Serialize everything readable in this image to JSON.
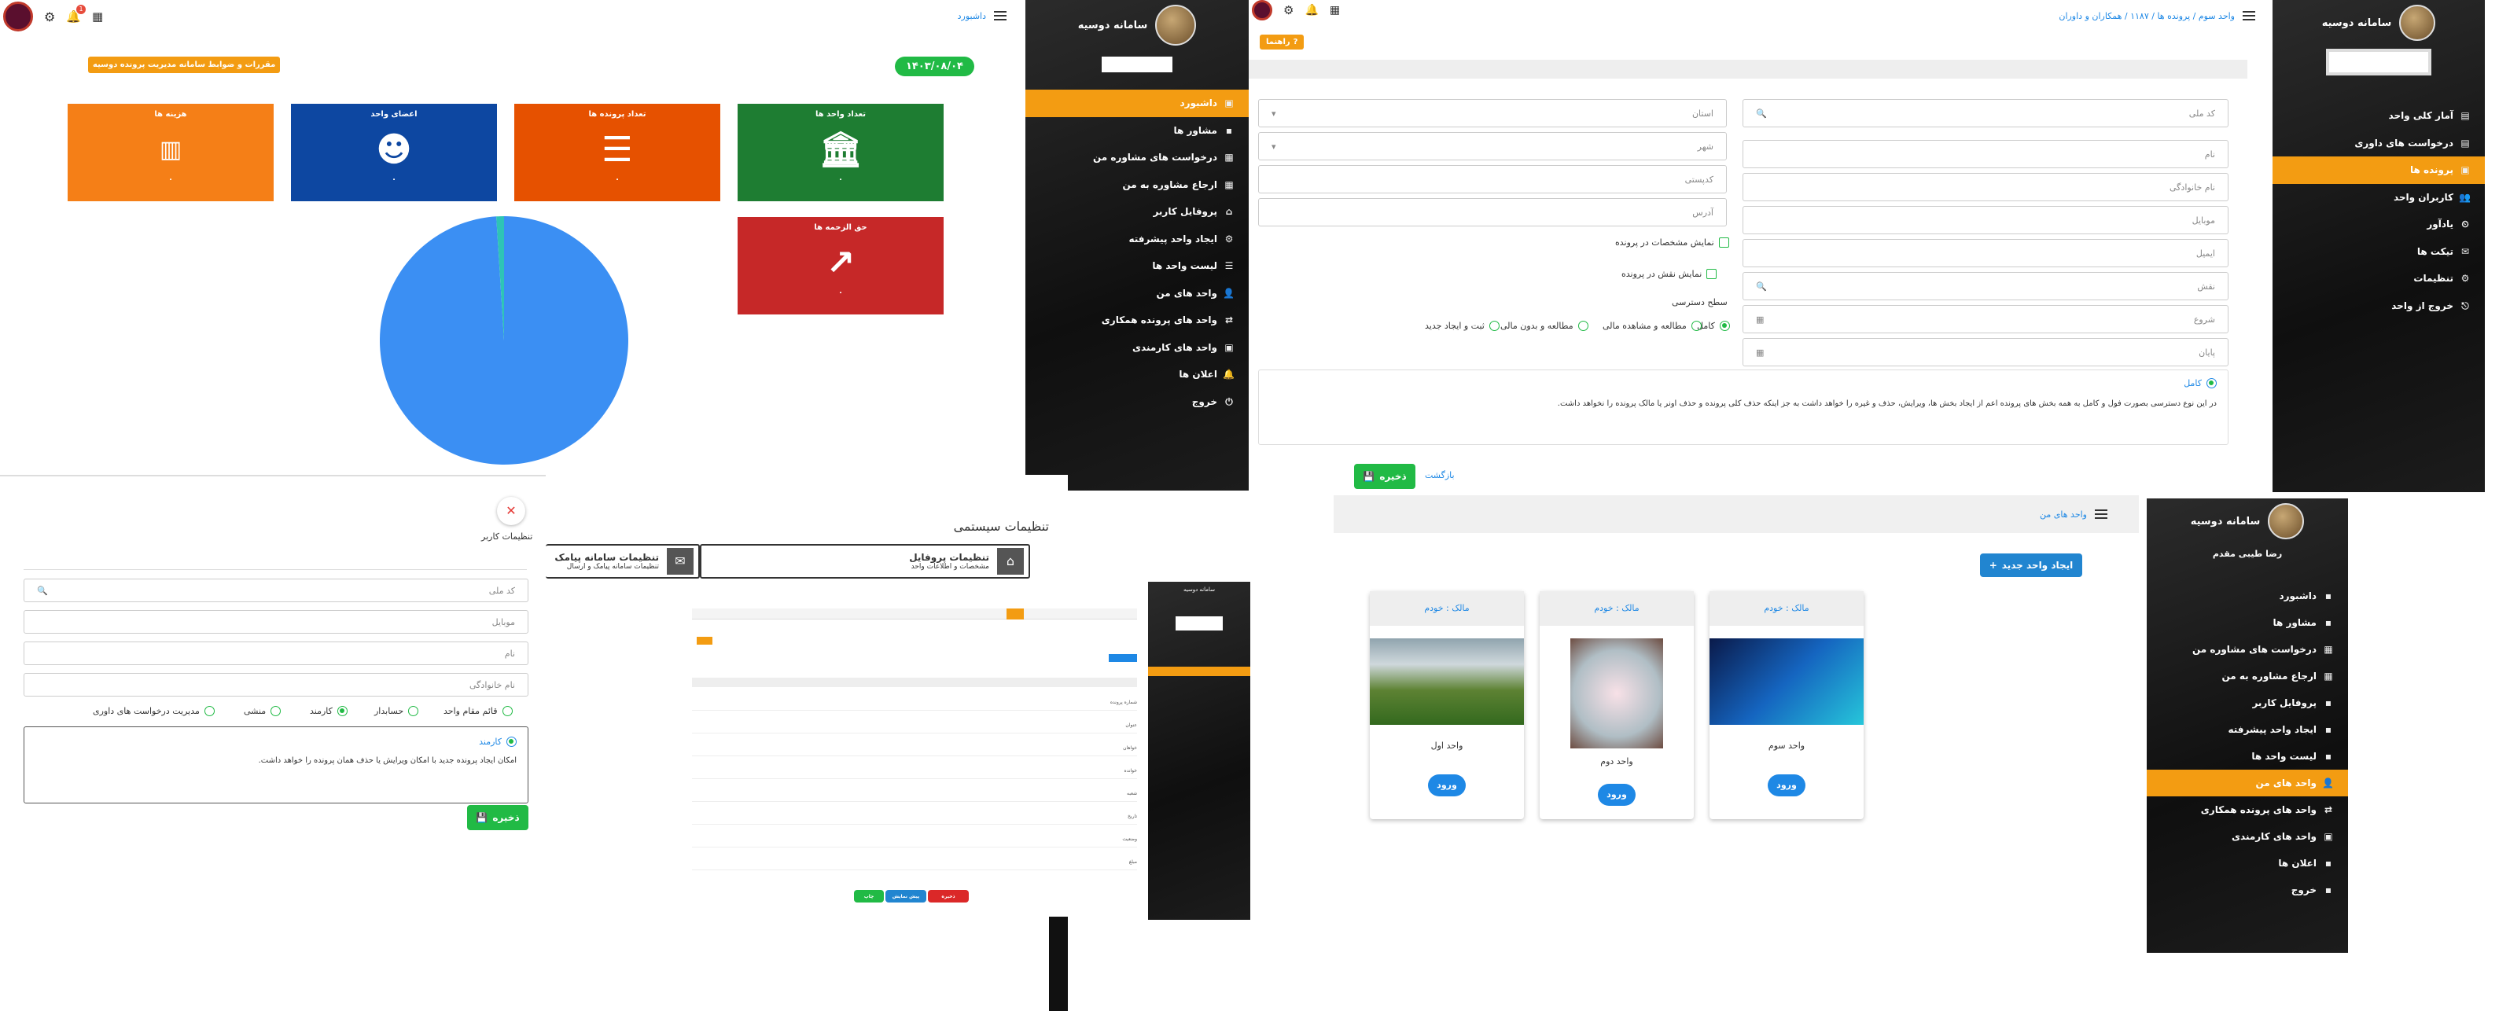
{
  "dash": {
    "breadcrumb": "داشبورد",
    "badge_count": "1",
    "pill": "۱۴۰۳/۰۸/۰۴",
    "notice": "مقررات و ضوابط سامانه مدیریت پرونده دوسیه",
    "cards": [
      {
        "title": "تعداد واحد ها",
        "value": "۰",
        "icon": "bank-icon"
      },
      {
        "title": "تعداد پرونده ها",
        "value": "۰",
        "icon": "document-icon"
      },
      {
        "title": "اعضای واحد",
        "value": "۰",
        "icon": "group-icon"
      },
      {
        "title": "هزینه ها",
        "value": "۰",
        "icon": "hundred-icon"
      },
      {
        "title": "حق الزحمه ها",
        "value": "۰",
        "icon": "chart-up-icon"
      }
    ]
  },
  "chart_data": {
    "type": "pie",
    "values": [
      99,
      1
    ],
    "colors": [
      "#3b8ff3",
      "#2ec4b6"
    ]
  },
  "sidebar1": {
    "title": "سامانه دوسیه",
    "items": [
      {
        "label": "داشبورد",
        "icon": "dashboard-icon",
        "active": true
      },
      {
        "label": "مشاور ها",
        "icon": "",
        "active": false
      },
      {
        "label": "درخواست های مشاوره من",
        "icon": "grid-icon",
        "active": false
      },
      {
        "label": "ارجاع مشاوره به من",
        "icon": "grid-icon",
        "active": false
      },
      {
        "label": "پروفایل کاربر",
        "icon": "home-icon",
        "active": false
      },
      {
        "label": "ایجاد واحد پیشرفته",
        "icon": "gear-icon",
        "active": false
      },
      {
        "label": "لیست واحد ها",
        "icon": "list-icon",
        "active": false
      },
      {
        "label": "واحد های من",
        "icon": "user-icon",
        "active": false
      },
      {
        "label": "واحد های پرونده همکاری",
        "icon": "share-icon",
        "active": false
      },
      {
        "label": "واحد های کارمندی",
        "icon": "badge-icon",
        "active": false
      },
      {
        "label": "اعلان ها",
        "icon": "bell-icon",
        "active": false
      },
      {
        "label": "خروج",
        "icon": "power-icon",
        "active": false
      }
    ]
  },
  "form": {
    "breadcrumb": "واحد سوم / پرونده ها / ۱۱۸۷ / همکاران و داوران",
    "help": "راهنما",
    "fields_right": [
      "کد ملی",
      "نام",
      "نام خانوادگی",
      "موبایل",
      "ایمیل",
      "نقش",
      "شروع",
      "پایان"
    ],
    "fields_left": [
      "استان",
      "شهر",
      "کدپستی",
      "آدرس"
    ],
    "check1": "نمایش مشخصات در پرونده",
    "check2": "نمایش نقش در پرونده",
    "access_label": "سطح دسترسی",
    "radios": [
      "کامل",
      "مطالعه و مشاهده مالی",
      "مطالعه و بدون مالی",
      "ثبت و ایجاد جدید"
    ],
    "info_title": "کامل",
    "info_text": "در این نوع دسترسی بصورت فول و کامل به همه بخش های پرونده اعم از ایجاد بخش ها، ویرایش، حذف و غیره را خواهد داشت به جز اینکه حذف کلی پرونده و حذف اونر یا مالک پرونده را نخواهد داشت.",
    "save": "ذخیره",
    "back": "بازگشت"
  },
  "sidebar2": {
    "title": "سامانه دوسیه",
    "items": [
      {
        "label": "آمار کلی واحد",
        "active": false
      },
      {
        "label": "درخواست های داوری",
        "active": false
      },
      {
        "label": "پرونده ها",
        "active": true
      },
      {
        "label": "کاربران واحد",
        "active": false
      },
      {
        "label": "یادآور",
        "active": false
      },
      {
        "label": "تیکت ها",
        "active": false
      },
      {
        "label": "تنظیمات",
        "active": false
      },
      {
        "label": "خروج از واحد",
        "active": false
      }
    ]
  },
  "settings": {
    "title": "تنظیمات سیستمی",
    "profile_title": "تنظیمات پروفایل",
    "profile_sub": "مشخصات و اطلاعات واحد",
    "sms_title": "تنظیمات سامانه پیامک",
    "sms_sub": "تنظیمات سامانه پیامک و ارسال"
  },
  "user": {
    "panel_title": "تنظیمات کاربر",
    "fields": [
      "کد ملی",
      "موبایل",
      "نام",
      "نام خانوادگی"
    ],
    "roles": [
      "قائم مقام واحد",
      "حسابدار",
      "کارمند",
      "منشی",
      "مدیریت درخواست های داوری"
    ],
    "info_title": "کارمند",
    "info_text": "امکان ایجاد پرونده جدید با امکان ویرایش یا حذف همان پرونده را خواهد داشت.",
    "save": "ذخیره"
  },
  "units": {
    "breadcrumb": "واحد های من",
    "create": "ایجاد واحد جدید",
    "list": [
      {
        "owner": "مالک : خودم",
        "name": "واحد سوم"
      },
      {
        "owner": "مالک : خودم",
        "name": "واحد دوم"
      },
      {
        "owner": "مالک : خودم",
        "name": "واحد اول"
      }
    ],
    "go": "ورود"
  },
  "sidebar3": {
    "title": "سامانه دوسیه",
    "user": "رضا طیبی مقدم",
    "items": [
      {
        "label": "داشبورد",
        "active": false
      },
      {
        "label": "مشاور ها",
        "active": false
      },
      {
        "label": "درخواست های مشاوره من",
        "active": false
      },
      {
        "label": "ارجاع مشاوره به من",
        "active": false
      },
      {
        "label": "پروفایل کاربر",
        "active": false
      },
      {
        "label": "ایجاد واحد پیشرفته",
        "active": false
      },
      {
        "label": "لیست واحد ها",
        "active": false
      },
      {
        "label": "واحد های من",
        "active": true
      },
      {
        "label": "واحد های پرونده همکاری",
        "active": false
      },
      {
        "label": "واحد های کارمندی",
        "active": false
      },
      {
        "label": "اعلان ها",
        "active": false
      },
      {
        "label": "خروج",
        "active": false
      }
    ]
  },
  "mini": {
    "title": "سامانه دوسیه",
    "rows": [
      "شماره پرونده",
      "عنوان",
      "خواهان",
      "خوانده",
      "شعبه",
      "تاریخ",
      "وضعیت",
      "مبلغ"
    ],
    "b1": "ذخیره",
    "b2": "چاپ",
    "b3": "پیش نمایش"
  }
}
